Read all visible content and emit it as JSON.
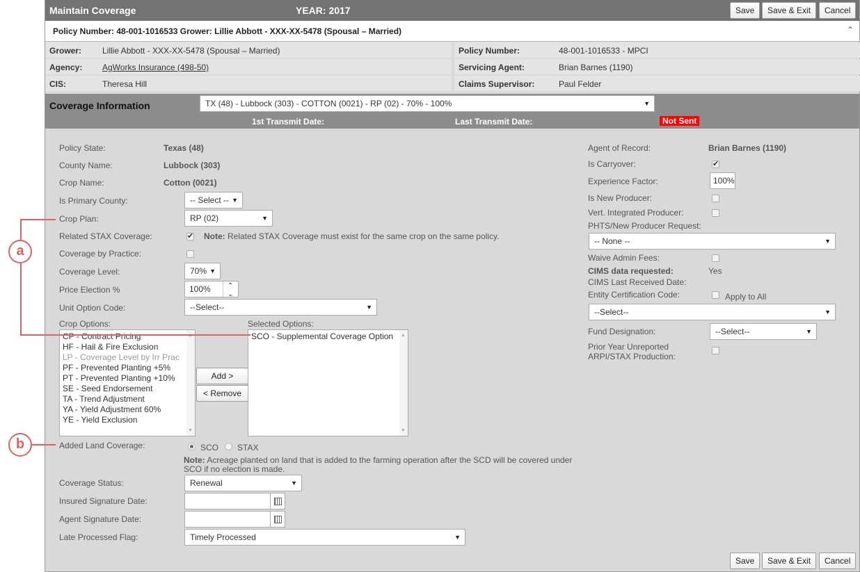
{
  "header": {
    "title": "Maintain Coverage",
    "year": "YEAR: 2017",
    "save": "Save",
    "save_exit": "Save & Exit",
    "cancel": "Cancel"
  },
  "policy_header": "Policy Number: 48-001-1016533 Grower: Lillie Abbott - XXX-XX-5478 (Spousal – Married)",
  "info": {
    "grower_label": "Grower:",
    "grower": "Lillie Abbott - XXX-XX-5478 (Spousal – Married)",
    "policy_label": "Policy Number:",
    "policy": "48-001-1016533 - MPCI",
    "agency_label": "Agency:",
    "agency": "AgWorks Insurance (498-50)",
    "agent_label": "Servicing Agent:",
    "agent": "Brian Barnes (1190)",
    "cis_label": "CIS:",
    "cis": "Theresa Hill",
    "claims_label": "Claims Supervisor:",
    "claims": "Paul Felder"
  },
  "coverage": {
    "label": "Coverage Information",
    "selected": "TX (48) - Lubbock (303) - COTTON (0021) - RP (02) - 70% - 100%",
    "first_transmit": "1st Transmit Date:",
    "last_transmit": "Last Transmit Date:",
    "status": "Not Sent"
  },
  "left": {
    "policy_state_label": "Policy State:",
    "policy_state": "Texas (48)",
    "county_label": "County Name:",
    "county": "Lubbock (303)",
    "crop_label": "Crop Name:",
    "crop": "Cotton (0021)",
    "primary_label": "Is Primary County:",
    "primary": "-- Select --",
    "plan_label": "Crop Plan:",
    "plan": "RP (02)",
    "stax_label": "Related STAX Coverage:",
    "stax_note_bold": "Note:",
    "stax_note": " Related STAX Coverage must exist for the same crop on the same policy.",
    "practice_label": "Coverage by Practice:",
    "level_label": "Coverage Level:",
    "level": "70%",
    "price_label": "Price Election %",
    "price": "100%",
    "unit_label": "Unit Option Code:",
    "unit": "--Select--",
    "crop_options_label": "Crop Options:",
    "crop_options": [
      "CP - Contract Pricing",
      "HF - Hail & Fire Exclusion",
      "LP - Coverage Level by Irr Prac",
      "PF - Prevented Planting +5%",
      "PT - Prevented Planting +10%",
      "SE - Seed Endorsement",
      "TA - Trend Adjustment",
      "YA - Yield Adjustment 60%",
      "YE - Yield Exclusion"
    ],
    "selected_options_label": "Selected Options:",
    "selected_options": [
      "SCO - Supplemental Coverage Option"
    ],
    "add": "Add >",
    "remove": "< Remove",
    "added_land_label": "Added Land Coverage:",
    "radio_sco": "SCO",
    "radio_stax": "STAX",
    "land_note_bold": "Note:",
    "land_note_1": " Acreage planted on land that is added to the farming operation after the SCD will be covered under",
    "land_note_2": "SCO if no election is made.",
    "status_label": "Coverage Status:",
    "status": "Renewal",
    "insured_sig_label": "Insured Signature Date:",
    "agent_sig_label": "Agent Signature Date:",
    "late_label": "Late Processed Flag:",
    "late": "Timely Processed"
  },
  "right": {
    "aor_label": "Agent of Record:",
    "aor": "Brian Barnes (1190)",
    "carryover_label": "Is Carryover:",
    "exp_label": "Experience Factor:",
    "exp": "100%",
    "new_producer_label": "Is New Producer:",
    "vert_label": "Vert. Integrated Producer:",
    "phts_label": "PHTS/New Producer Request:",
    "phts": "-- None --",
    "waive_label": "Waive Admin Fees:",
    "cims_label": "CIMS data requested:",
    "cims": "Yes",
    "cims_last_label": "CIMS Last Received Date:",
    "entity_label": "Entity Certification Code:",
    "apply_all": "Apply to All",
    "entity": "--Select--",
    "fund_label": "Fund Designation:",
    "fund": "--Select--",
    "prior_label_1": "Prior Year Unreported",
    "prior_label_2": "ARPI/STAX Production:"
  },
  "callouts": {
    "a": "a",
    "b": "b"
  }
}
